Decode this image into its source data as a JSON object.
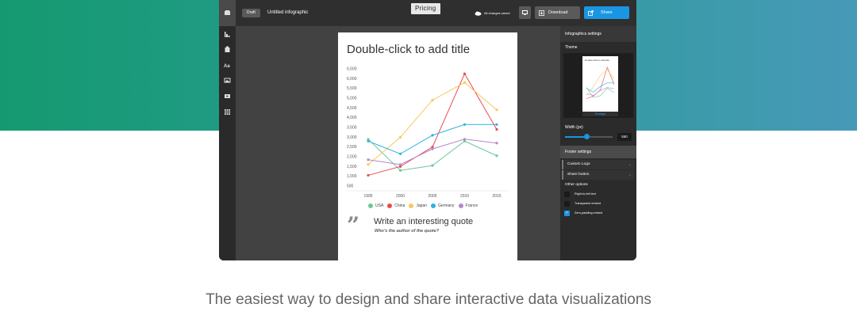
{
  "header": {
    "draft_label": "Draft",
    "doc_title": "Untitled infographic",
    "pricing_label": "Pricing",
    "saved_status": "All changes saved",
    "download_label": "Download",
    "share_label": "Share"
  },
  "rail": {
    "icons": [
      "home-icon",
      "chart-icon",
      "map-icon",
      "text-icon",
      "image-icon",
      "video-icon",
      "grid-icon"
    ]
  },
  "canvas": {
    "title": "Double-click to add title",
    "quote": "Write an interesting quote",
    "quote_author": "Who's the author of the quote?"
  },
  "chart_data": {
    "type": "line",
    "x": [
      1995,
      2000,
      2005,
      2010,
      2015
    ],
    "xlabels": [
      "1995",
      "2000",
      "2005",
      "2010",
      "2015"
    ],
    "yticks": [
      500,
      1000,
      1500,
      2000,
      2500,
      3000,
      3500,
      4000,
      4500,
      5000,
      5500,
      6000,
      6500
    ],
    "ytick_labels": [
      "500",
      "1,000",
      "1,500",
      "2,000",
      "2,500",
      "3,000",
      "3,500",
      "4,000",
      "4,500",
      "5,000",
      "5,500",
      "6,000",
      "6,500"
    ],
    "ylim": [
      500,
      6500
    ],
    "series": [
      {
        "name": "USA",
        "color": "#6cc79a",
        "values": [
          2900,
          1300,
          1550,
          2800,
          2050
        ]
      },
      {
        "name": "China",
        "color": "#e84a50",
        "values": [
          1050,
          1500,
          2500,
          6250,
          3400
        ]
      },
      {
        "name": "Japan",
        "color": "#f8c85a",
        "values": [
          1600,
          3000,
          4900,
          5800,
          4400
        ]
      },
      {
        "name": "Germany",
        "color": "#2eb1e0",
        "values": [
          2800,
          2150,
          3100,
          3650,
          3650
        ]
      },
      {
        "name": "France",
        "color": "#b787cf",
        "values": [
          1850,
          1600,
          2400,
          2900,
          2700
        ]
      }
    ]
  },
  "settings": {
    "title": "Infographics settings",
    "theme_label": "Theme",
    "theme_thumb_title": "Double-click to add title",
    "change_label": "Change",
    "width_label": "Width (px)",
    "width_value": "550",
    "width_fraction": 0.45,
    "footer_title": "Footer settings",
    "custom_logo": "Custom Logo",
    "share_button": "Share button",
    "other_options": "Other options",
    "options": [
      {
        "label": "Right-to-left text",
        "checked": false
      },
      {
        "label": "Transparent embed",
        "checked": false
      },
      {
        "label": "Zero-padding embed",
        "checked": true
      }
    ]
  },
  "tagline": "The easiest way to design and share interactive data visualizations",
  "colors": {
    "accent": "#1a95e2",
    "hero_left": "#159a70",
    "hero_right": "#4799b8"
  }
}
